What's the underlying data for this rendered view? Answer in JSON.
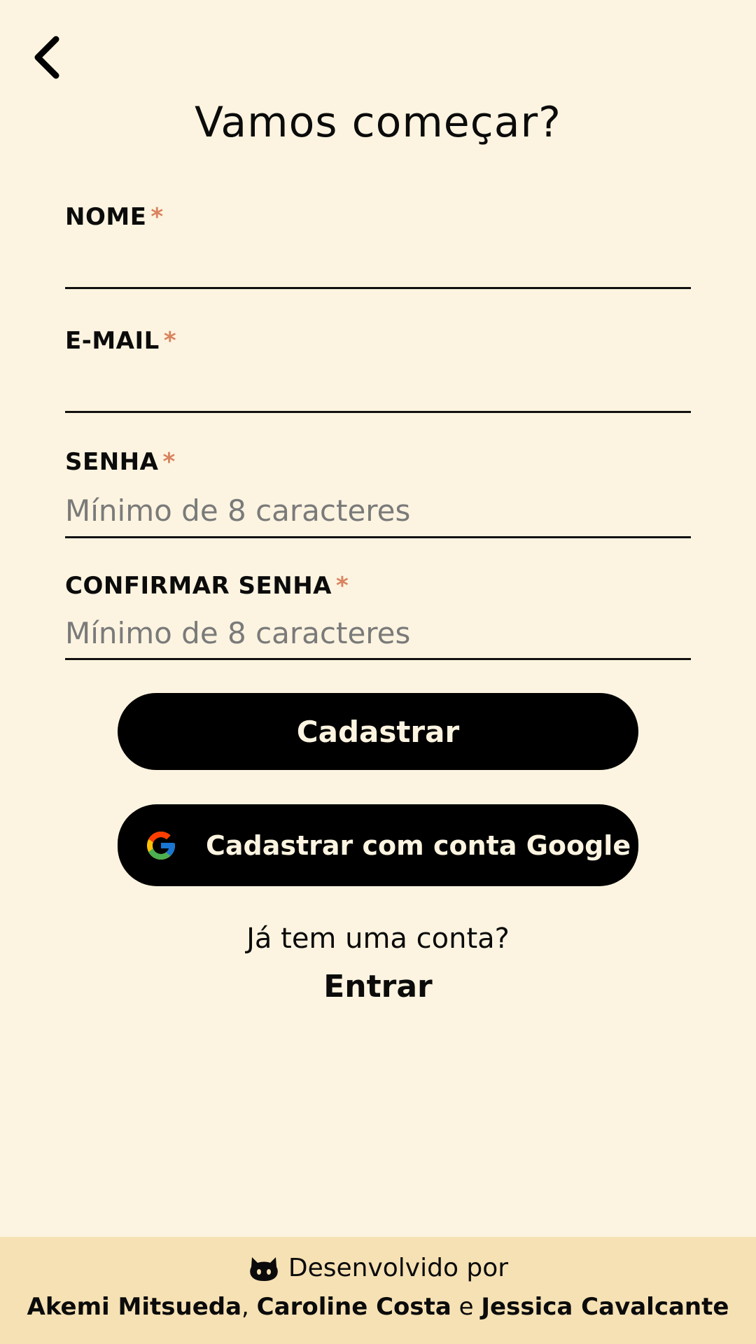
{
  "header": {
    "back_icon": "chevron-left-icon",
    "title": "Vamos começar?"
  },
  "form": {
    "required_marker": "*",
    "name": {
      "label": "NOME",
      "placeholder": "",
      "value": ""
    },
    "email": {
      "label": "E-MAIL",
      "placeholder": "",
      "value": ""
    },
    "password": {
      "label": "SENHA",
      "placeholder": "Mínimo de 8 caracteres",
      "value": ""
    },
    "confirm_password": {
      "label": "CONFIRMAR SENHA",
      "placeholder": "Mínimo de 8 caracteres",
      "value": ""
    }
  },
  "actions": {
    "register_label": "Cadastrar",
    "google_register_label": "Cadastrar com conta Google",
    "google_icon": "google-icon"
  },
  "login_prompt": {
    "question": "Já tem uma conta?",
    "link_label": "Entrar"
  },
  "footer": {
    "icon": "github-icon",
    "developed_by": "Desenvolvido por",
    "author_1": "Akemi Mitsueda",
    "separator_1": ", ",
    "author_2": "Caroline Costa",
    "separator_2": " e ",
    "author_3": "Jessica Cavalcante"
  },
  "colors": {
    "background": "#fcf4e0",
    "footer_background": "#f6e1b4",
    "accent_asterisk": "#d9835f",
    "button_background": "#000000",
    "button_text": "#fcf4e0"
  }
}
